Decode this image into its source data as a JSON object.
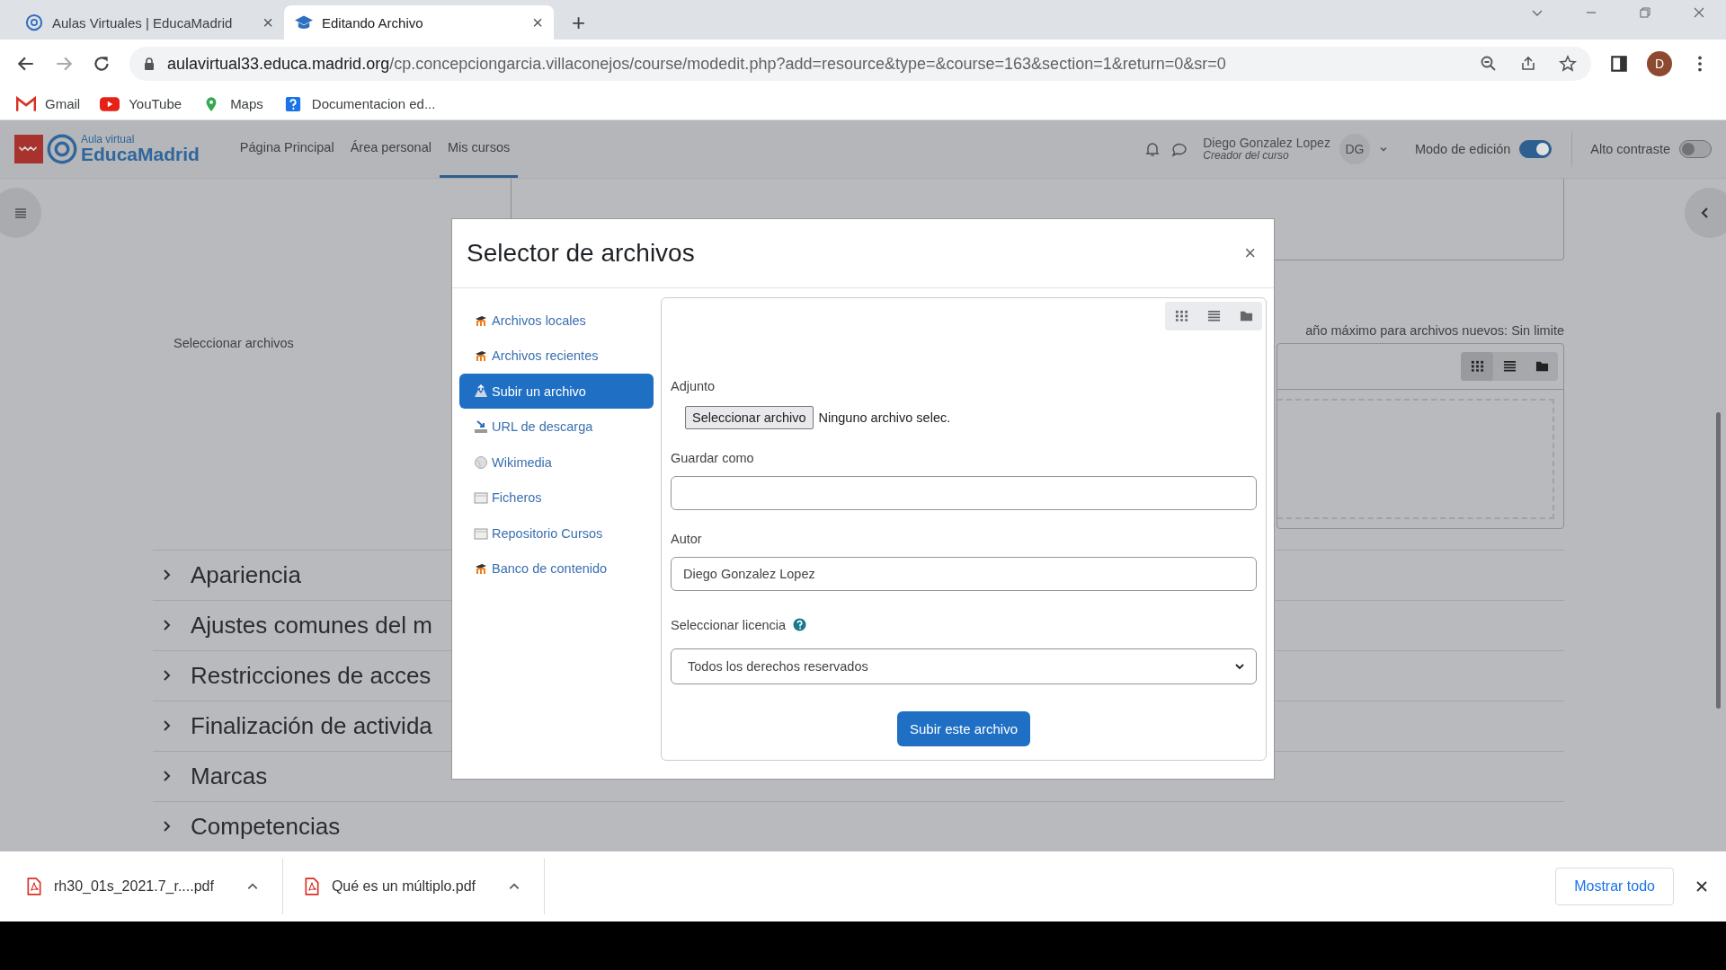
{
  "browser": {
    "tabs": [
      {
        "title": "Aulas Virtuales | EducaMadrid",
        "selected": false,
        "close": "×"
      },
      {
        "title": "Editando Archivo",
        "selected": true,
        "close": "×"
      }
    ],
    "new_tab": "+",
    "url": {
      "host": "aulavirtual33.educa.madrid.org",
      "path": "/cp.concepciongarcia.villaconejos/course/modedit.php?add=resource&type=&course=163&section=1&return=0&sr=0"
    },
    "profile_initial": "D",
    "bookmarks": [
      {
        "label": "Gmail",
        "kind": "mail"
      },
      {
        "label": "YouTube",
        "kind": "video"
      },
      {
        "label": "Maps",
        "kind": "pin"
      },
      {
        "label": "Documentacion ed...",
        "kind": "help"
      }
    ]
  },
  "header": {
    "logo_small": "Aula virtual",
    "logo_big": "EducaMadrid",
    "nav": [
      {
        "label": "Página Principal",
        "selected": false
      },
      {
        "label": "Área personal",
        "selected": false
      },
      {
        "label": "Mis cursos",
        "selected": true
      }
    ],
    "user": {
      "name": "Diego Gonzalez Lopez",
      "role": "Creador del curso",
      "initials": "DG"
    },
    "toggles": [
      {
        "label": "Modo de edición",
        "on": true
      },
      {
        "label": "Alto contraste",
        "on": false
      }
    ]
  },
  "form": {
    "files_label": "Seleccionar archivos",
    "max_size_note": "año máximo para archivos nuevos: Sin limite",
    "sections": [
      "Apariencia",
      "Ajustes comunes del m",
      "Restricciones de acces",
      "Finalización de activida",
      "Marcas",
      "Competencias"
    ]
  },
  "dialog": {
    "title": "Selector de archivos",
    "close": "×",
    "repositories": [
      {
        "label": "Archivos locales",
        "kind": "moodle",
        "selected": false
      },
      {
        "label": "Archivos recientes",
        "kind": "moodle",
        "selected": false
      },
      {
        "label": "Subir un archivo",
        "kind": "upload",
        "selected": true
      },
      {
        "label": "URL de descarga",
        "kind": "url",
        "selected": false
      },
      {
        "label": "Wikimedia",
        "kind": "wiki",
        "selected": false
      },
      {
        "label": "Ficheros",
        "kind": "box",
        "selected": false
      },
      {
        "label": "Repositorio Cursos",
        "kind": "box",
        "selected": false
      },
      {
        "label": "Banco de contenido",
        "kind": "moodle",
        "selected": false
      }
    ],
    "attachment_label": "Adjunto",
    "choose_button": "Seleccionar archivo",
    "no_file": "Ninguno archivo selec.",
    "save_as_label": "Guardar como",
    "author_label": "Autor",
    "author_value": "Diego Gonzalez Lopez",
    "license_label": "Seleccionar licencia",
    "license_value": "Todos los derechos reservados",
    "submit": "Subir este archivo"
  },
  "downloads": {
    "items": [
      "rh30_01s_2021.7_r....pdf",
      "Qué es un múltiplo.pdf"
    ],
    "show_all": "Mostrar todo"
  }
}
